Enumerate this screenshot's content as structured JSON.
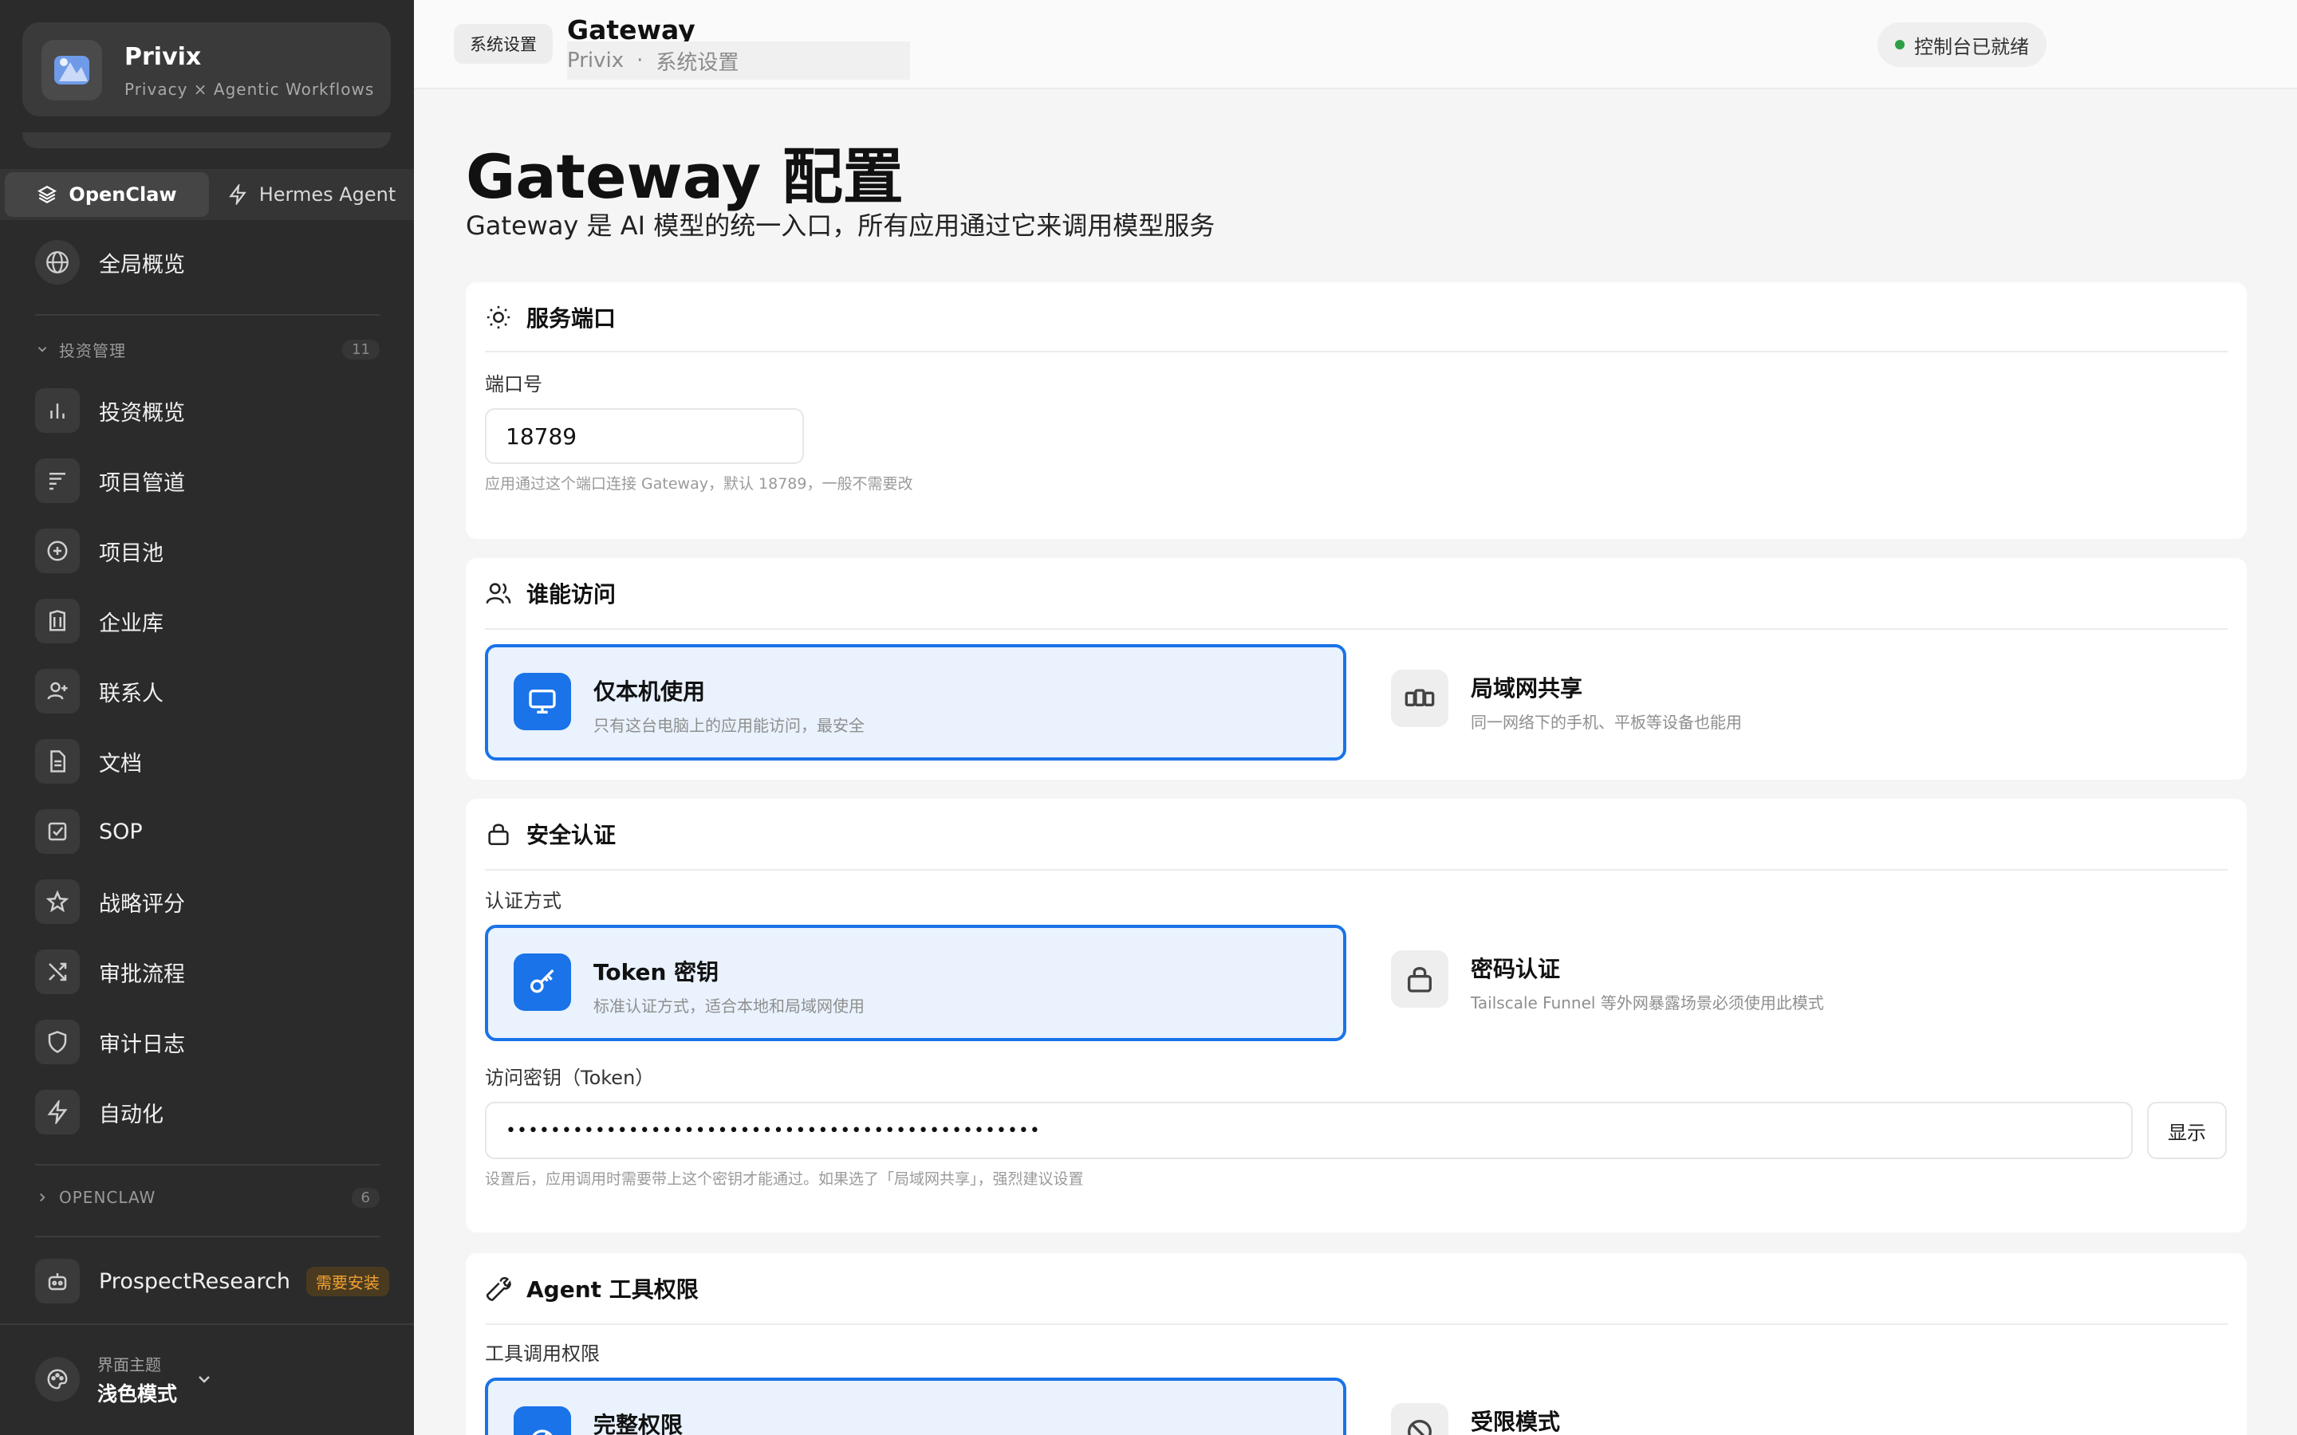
{
  "sidebar": {
    "brand": {
      "name": "Privix",
      "subtitle": "Privacy × Agentic Workflows"
    },
    "tabs": [
      {
        "label": "OpenClaw",
        "icon": "layers-icon",
        "active": true
      },
      {
        "label": "Hermes Agent",
        "icon": "bolt-icon",
        "active": false
      }
    ],
    "overview": {
      "label": "全局概览",
      "icon": "globe-icon"
    },
    "group_invest": {
      "label": "投资管理",
      "count": "11"
    },
    "items": [
      {
        "label": "投资概览",
        "icon": "bar-chart-icon"
      },
      {
        "label": "项目管道",
        "icon": "pipeline-icon"
      },
      {
        "label": "项目池",
        "icon": "plus-circle-icon"
      },
      {
        "label": "企业库",
        "icon": "building-icon"
      },
      {
        "label": "联系人",
        "icon": "user-plus-icon"
      },
      {
        "label": "文档",
        "icon": "document-icon"
      },
      {
        "label": "SOP",
        "icon": "checkbox-icon"
      },
      {
        "label": "战略评分",
        "icon": "star-icon"
      },
      {
        "label": "审批流程",
        "icon": "shuffle-icon"
      },
      {
        "label": "审计日志",
        "icon": "shield-icon"
      },
      {
        "label": "自动化",
        "icon": "bolt-icon"
      }
    ],
    "group_openclaw": {
      "label": "OPENCLAW",
      "count": "6"
    },
    "prospect": {
      "label": "ProspectResearch",
      "badge": "需要安装",
      "icon": "robot-icon"
    },
    "theme": {
      "label": "界面主题",
      "value": "浅色模式",
      "icon": "palette-icon"
    }
  },
  "header": {
    "pill": "系统设置",
    "title": "Gateway",
    "breadcrumb": [
      "Privix",
      "·",
      "系统设置"
    ],
    "status": "控制台已就绪"
  },
  "main": {
    "title": "Gateway 配置",
    "description": "Gateway 是 AI 模型的统一入口，所有应用通过它来调用模型服务",
    "port_card": {
      "title": "服务端口",
      "field_label": "端口号",
      "port_value": "18789",
      "hint": "应用通过这个端口连接 Gateway，默认 18789，一般不需要改"
    },
    "access_card": {
      "title": "谁能访问",
      "options": [
        {
          "title": "仅本机使用",
          "desc": "只有这台电脑上的应用能访问，最安全",
          "selected": true
        },
        {
          "title": "局域网共享",
          "desc": "同一网络下的手机、平板等设备也能用",
          "selected": false
        }
      ]
    },
    "auth_card": {
      "title": "安全认证",
      "method_label": "认证方式",
      "options": [
        {
          "title": "Token 密钥",
          "desc": "标准认证方式，适合本地和局域网使用",
          "selected": true
        },
        {
          "title": "密码认证",
          "desc": "Tailscale Funnel 等外网暴露场景必须使用此模式",
          "selected": false
        }
      ],
      "token_label": "访问密钥（Token）",
      "token_value": "••••••••••••••••••••••••••••••••••••••••••••••••",
      "show_button": "显示",
      "hint": "设置后，应用调用时需要带上这个密钥才能通过。如果选了「局域网共享」，强烈建议设置"
    },
    "tools_card": {
      "title": "Agent 工具权限",
      "field_label": "工具调用权限",
      "options": [
        {
          "title": "完整权限",
          "selected": true
        },
        {
          "title": "受限模式",
          "selected": false
        }
      ]
    }
  }
}
